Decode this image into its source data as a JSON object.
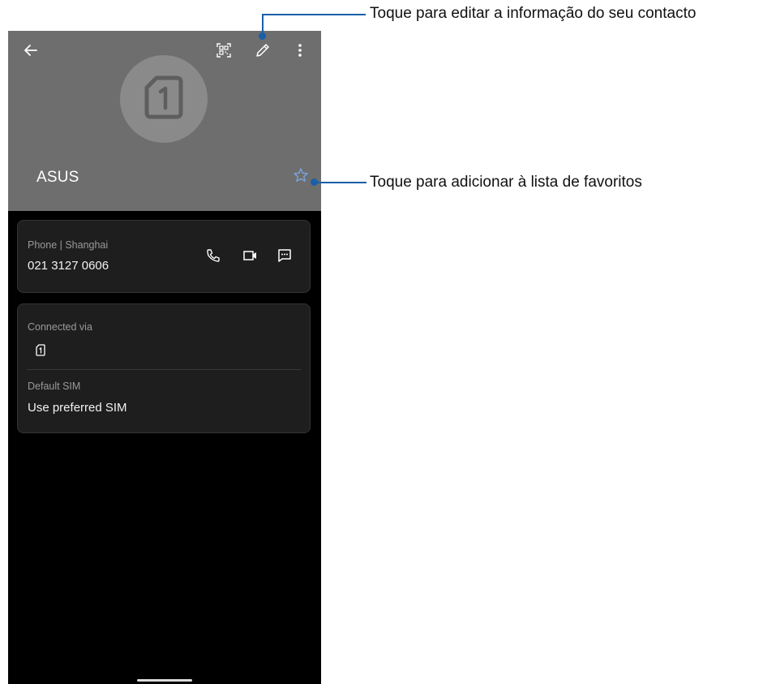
{
  "header": {
    "back_icon": "arrow-left-icon",
    "qr_icon": "qr-code-icon",
    "edit_icon": "pencil-icon",
    "more_icon": "more-vertical-icon",
    "avatar_icon": "sim-card-1-icon",
    "contact_name": "ASUS",
    "favorite_icon": "star-outline-icon"
  },
  "phone_card": {
    "label": "Phone | Shanghai",
    "number": "021 3127 0606",
    "call_icon": "phone-icon",
    "video_icon": "video-icon",
    "message_icon": "message-icon"
  },
  "sim_card": {
    "connected_label": "Connected via",
    "connected_icon": "sim-card-1-icon",
    "default_label": "Default SIM",
    "default_value": "Use preferred SIM"
  },
  "callouts": {
    "edit_text": "Toque para editar a informação do seu contacto",
    "favorite_text": "Toque para adicionar à lista de favoritos"
  },
  "colors": {
    "header_bg": "#6e6e6e",
    "screen_bg": "#000000",
    "card_bg": "#1e1e1e",
    "star_accent": "#7aa6e0",
    "callout": "#1a5fa8"
  }
}
